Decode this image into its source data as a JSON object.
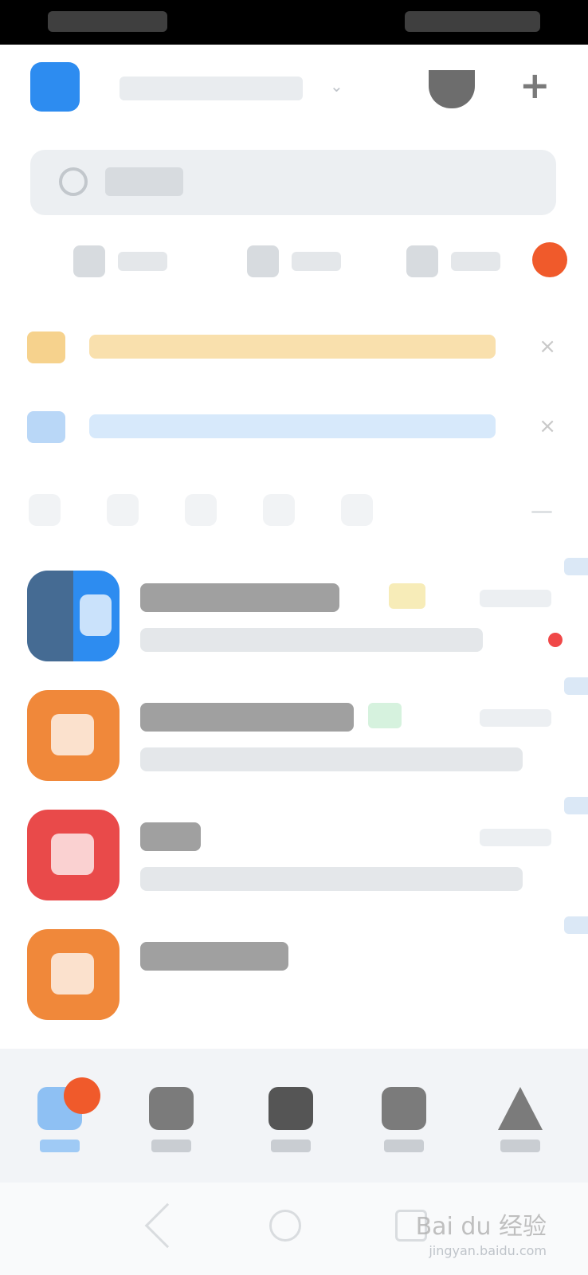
{
  "system": {
    "watermark": "Bai du 经验",
    "watermark_sub": "jingyan.baidu.com"
  },
  "colors": {
    "accent_blue": "#2d8cf0",
    "banner_yellow": "#f4c069",
    "banner_blue": "#8ec0f3",
    "orange_badge": "#f05a2b",
    "red_dot": "#f04848"
  },
  "icons": {
    "header": [
      "app-logo",
      "shield-icon",
      "plus-icon"
    ],
    "search": "search-icon",
    "banners": [
      "gift-icon",
      "user-bell-icon"
    ],
    "bottom_nav": [
      "home-icon",
      "chat-icon",
      "grid-icon",
      "box-icon",
      "person-icon"
    ],
    "system_nav": [
      "back-icon",
      "home-circle-icon",
      "recent-icon"
    ]
  }
}
